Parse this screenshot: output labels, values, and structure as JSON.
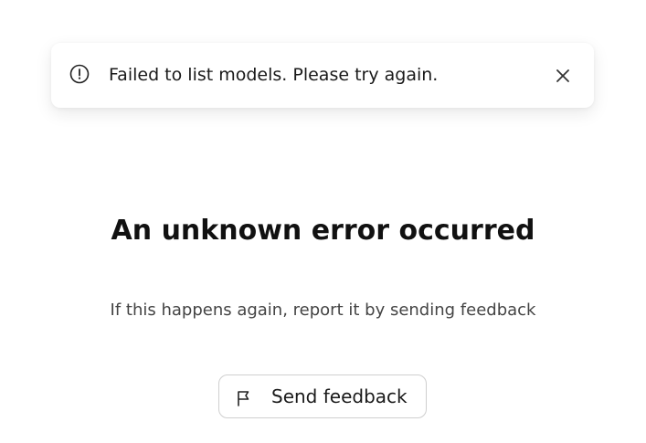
{
  "toast": {
    "message": "Failed to list models. Please try again.",
    "icon": "alert-circle-icon",
    "close_icon": "close-icon"
  },
  "error": {
    "title": "An unknown error occurred",
    "description": "If this happens again, report it by sending feedback"
  },
  "feedback_button": {
    "label": "Send feedback",
    "icon": "flag-icon"
  }
}
